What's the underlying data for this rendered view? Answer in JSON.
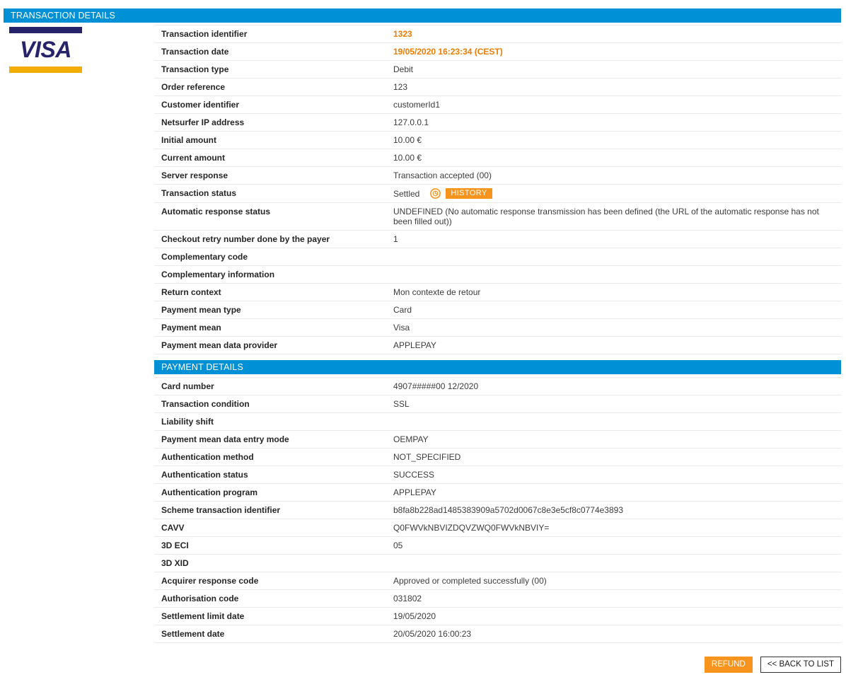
{
  "transaction_section": {
    "title": "TRANSACTION DETAILS",
    "logo": {
      "name": "visa-logo",
      "text": "VISA",
      "bar_top_color": "#26236a",
      "bar_bottom_color": "#f2ae00",
      "wordmark_color": "#26236a"
    },
    "rows": [
      {
        "label": "Transaction identifier",
        "value": "1323",
        "highlight": true
      },
      {
        "label": "Transaction date",
        "value": "19/05/2020 16:23:34 (CEST)",
        "highlight": true
      },
      {
        "label": "Transaction type",
        "value": "Debit",
        "highlight": false
      },
      {
        "label": "Order reference",
        "value": "123",
        "highlight": false
      },
      {
        "label": "Customer identifier",
        "value": "customerId1",
        "highlight": false
      },
      {
        "label": "Netsurfer IP address",
        "value": "127.0.0.1",
        "highlight": false
      },
      {
        "label": "Initial amount",
        "value": "10.00 €",
        "highlight": false
      },
      {
        "label": "Current amount",
        "value": "10.00 €",
        "highlight": false
      },
      {
        "label": "Server response",
        "value": "Transaction accepted (00)",
        "highlight": false
      },
      {
        "label": "Transaction status",
        "value": "Settled",
        "highlight": false,
        "badge": "HISTORY",
        "icon": "history-clock-icon"
      },
      {
        "label": "Automatic response status",
        "value": "UNDEFINED (No automatic response transmission has been defined (the URL of the automatic response has not been filled out))",
        "highlight": false
      },
      {
        "label": "Checkout retry number done by the payer",
        "value": "1",
        "highlight": false
      },
      {
        "label": "Complementary code",
        "value": "",
        "highlight": false
      },
      {
        "label": "Complementary information",
        "value": "",
        "highlight": false
      },
      {
        "label": "Return context",
        "value": "Mon contexte de retour",
        "highlight": false
      },
      {
        "label": "Payment mean type",
        "value": "Card",
        "highlight": false
      },
      {
        "label": "Payment mean",
        "value": "Visa",
        "highlight": false
      },
      {
        "label": "Payment mean data provider",
        "value": "APPLEPAY",
        "highlight": false
      }
    ]
  },
  "payment_section": {
    "title": "PAYMENT DETAILS",
    "rows": [
      {
        "label": "Card number",
        "value": "4907#####00  12/2020"
      },
      {
        "label": "Transaction condition",
        "value": "SSL"
      },
      {
        "label": "Liability shift",
        "value": ""
      },
      {
        "label": "Payment mean data entry mode",
        "value": "OEMPAY"
      },
      {
        "label": "Authentication method",
        "value": "NOT_SPECIFIED"
      },
      {
        "label": "Authentication status",
        "value": "SUCCESS"
      },
      {
        "label": "Authentication program",
        "value": "APPLEPAY"
      },
      {
        "label": "Scheme transaction identifier",
        "value": "b8fa8b228ad1485383909a5702d0067c8e3e5cf8c0774e3893"
      },
      {
        "label": "CAVV",
        "value": "Q0FWVkNBVIZDQVZWQ0FWVkNBVIY="
      },
      {
        "label": "3D ECI",
        "value": "05"
      },
      {
        "label": "3D XID",
        "value": ""
      },
      {
        "label": "Acquirer response code",
        "value": "Approved or completed successfully (00)"
      },
      {
        "label": "Authorisation code",
        "value": "031802"
      },
      {
        "label": "Settlement limit date",
        "value": "19/05/2020"
      },
      {
        "label": "Settlement date",
        "value": "20/05/2020 16:00:23"
      }
    ]
  },
  "actions": {
    "refund_label": "REFUND",
    "back_label": "<< BACK TO LIST"
  },
  "colors": {
    "section_bar": "#0090d6",
    "accent_orange": "#f7941e",
    "highlight_value": "#f07c00"
  }
}
